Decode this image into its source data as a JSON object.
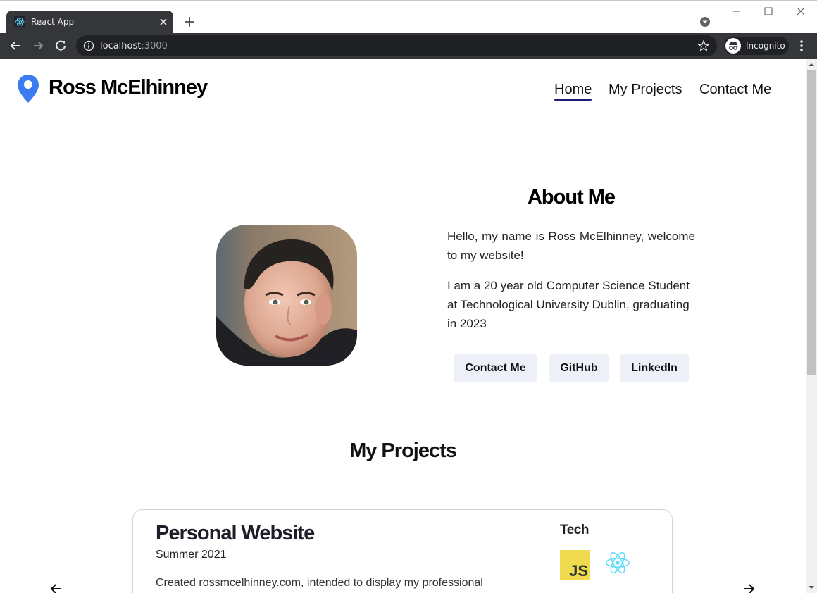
{
  "browser": {
    "tab_title": "React App",
    "url_host": "localhost",
    "url_port": ":3000",
    "incognito_label": "Incognito"
  },
  "nav": {
    "site_name": "Ross McElhinney",
    "links": [
      "Home",
      "My Projects",
      "Contact Me"
    ],
    "active_link": "Home",
    "accent": "#1f1a7a",
    "pin_color": "#3b7cf0"
  },
  "about": {
    "title": "About Me",
    "paragraph1": "Hello, my name is Ross McElhinney, welcome to my website!",
    "paragraph2": "I am a 20 year old Computer Science Student at Technological University Dublin, graduating in 2023",
    "buttons": [
      "Contact Me",
      "GitHub",
      "LinkedIn"
    ]
  },
  "projects": {
    "title": "My Projects",
    "items": [
      {
        "name": "Personal Website",
        "date": "Summer 2021",
        "description": "Created rossmcelhinney.com, intended to display my professional",
        "tech_label": "Tech",
        "tech": [
          "js-icon",
          "react-icon"
        ]
      }
    ]
  }
}
